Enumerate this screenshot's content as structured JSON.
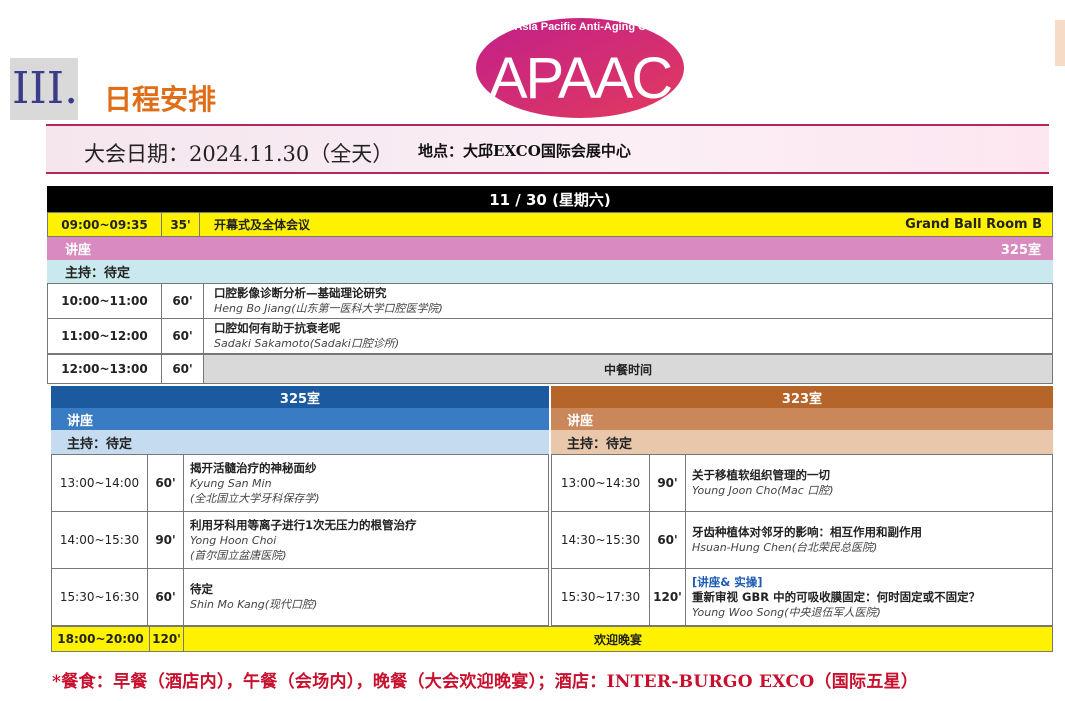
{
  "header": {
    "section_number": "III.",
    "section_title": "日程安排",
    "logo": {
      "text": "APAAC",
      "tagline": "Asia Pacific Anti-Aging Confer"
    }
  },
  "info": {
    "date": "大会日期：2024.11.30（全天）",
    "location": "地点：大邱EXCO国际会展中心"
  },
  "day_header": "11 / 30 (星期六)",
  "opening": {
    "time": "09:00~09:35",
    "duration": "35'",
    "title": "开幕式及全体会议",
    "room": "Grand Ball Room B"
  },
  "lecture_bar": {
    "label": "讲座",
    "room": "325室"
  },
  "host_bar": {
    "label": "主持：待定"
  },
  "morning_talks": [
    {
      "time": "10:00~11:00",
      "duration": "60'",
      "title": "口腔影像诊断分析—基础理论研究",
      "speaker": "Heng Bo Jiang(山东第一医科大学口腔医学院)"
    },
    {
      "time": "11:00~12:00",
      "duration": "60'",
      "title": "口腔如何有助于抗衰老呢",
      "speaker": "Sadaki Sakamoto(Sadaki口腔诊所)"
    }
  ],
  "lunch": {
    "time": "12:00~13:00",
    "duration": "60'",
    "label": "中餐时间"
  },
  "left_track": {
    "room": "325室",
    "lecture": "讲座",
    "host": "主持：待定",
    "talks": [
      {
        "time": "13:00~14:00",
        "duration": "60'",
        "title": "揭开活髓治疗的神秘面纱",
        "speaker": "Kyung San Min",
        "affiliation": "(全北国立大学牙科保存学)"
      },
      {
        "time": "14:00~15:30",
        "duration": "90'",
        "title": "利用牙科用等离子进行1次无压力的根管治疗",
        "speaker": "Yong Hoon Choi",
        "affiliation": "(首尔国立盆唐医院)"
      },
      {
        "time": "15:30~16:30",
        "duration": "60'",
        "title": "待定",
        "speaker": "Shin Mo Kang(现代口腔)",
        "affiliation": ""
      }
    ]
  },
  "right_track": {
    "room": "323室",
    "lecture": "讲座",
    "host": "主持：待定",
    "talks": [
      {
        "time": "13:00~14:30",
        "duration": "90'",
        "tag": "",
        "title": "关于移植软组织管理的一切",
        "speaker": "Young Joon Cho(Mac 口腔)"
      },
      {
        "time": "14:30~15:30",
        "duration": "60'",
        "tag": "",
        "title": "牙齿种植体对邻牙的影响：相互作用和副作用",
        "speaker": "Hsuan-Hung Chen(台北荣民总医院)"
      },
      {
        "time": "15:30~17:30",
        "duration": "120'",
        "tag": "[讲座& 实操]",
        "title": "重新审视 GBR 中的可吸收膜固定：何时固定或不固定？",
        "speaker": "Young Woo Song(中央退伍军人医院)"
      }
    ]
  },
  "dinner": {
    "time": "18:00~20:00",
    "duration": "120'",
    "label": "欢迎晚宴"
  },
  "footer": "*餐食：早餐（酒店内），午餐（会场内），晚餐（大会欢迎晚宴）；酒店：INTER-BURGO EXCO（国际五星）",
  "colors": {
    "yellow": "#fff200",
    "pink_band": "#d98bbf",
    "cyan_band": "#c9e9ee",
    "blue_header": "#1c5aa0",
    "blue_band": "#3a7cc3",
    "light_blue_band": "#c5dcf0",
    "brown_header": "#b5652a",
    "brown_band": "#c9875a",
    "tan_band": "#e8c7ab",
    "grey_row": "#d9d9d9",
    "accent_orange": "#e06d17",
    "footer_red": "#c8102e"
  }
}
